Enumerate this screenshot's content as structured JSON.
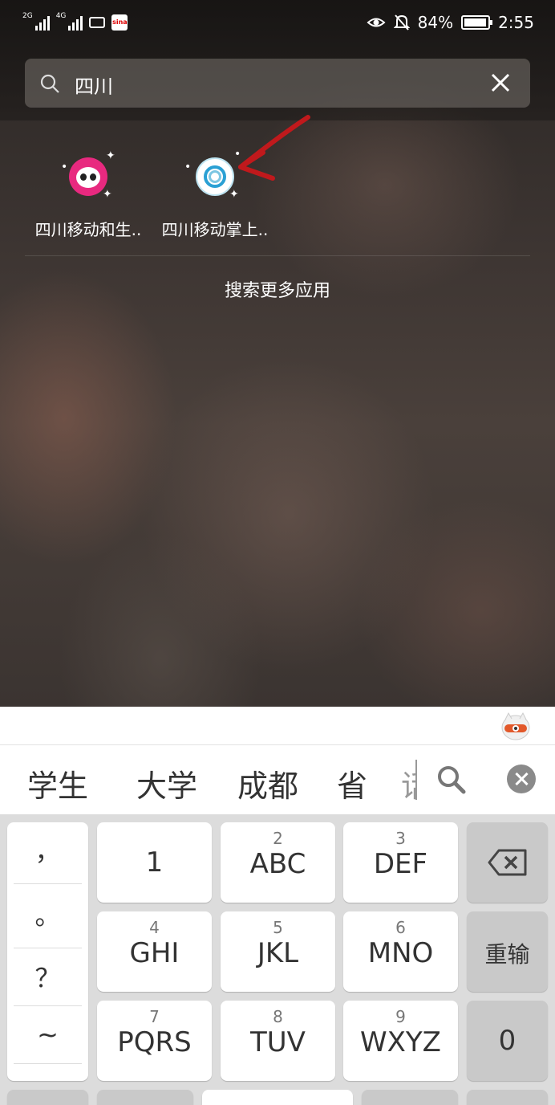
{
  "status_bar": {
    "network_1": "2G",
    "network_2": "4G",
    "battery_percent": "84%",
    "battery_level": 0.84,
    "time": "2:55"
  },
  "search": {
    "query": "四川"
  },
  "apps": [
    {
      "label": "四川移动和生..",
      "icon": "panda-app-icon"
    },
    {
      "label": "四川移动掌上..",
      "icon": "china-mobile-icon"
    }
  ],
  "more_apps": "搜索更多应用",
  "annotation_color": "#c0191c",
  "keyboard": {
    "candidates": [
      "学生",
      "大学",
      "成都",
      "省",
      "话"
    ],
    "punctuation": [
      "，",
      "。",
      "？",
      "~"
    ],
    "row1": {
      "k1": "1",
      "k2_num": "2",
      "k2": "ABC",
      "k3_num": "3",
      "k3": "DEF"
    },
    "row2": {
      "k1_num": "4",
      "k1": "GHI",
      "k2_num": "5",
      "k2": "JKL",
      "k3_num": "6",
      "k3": "MNO",
      "side": "重输"
    },
    "row3": {
      "k1_num": "7",
      "k1": "PQRS",
      "k2_num": "8",
      "k2": "TUV",
      "k3_num": "9",
      "k3": "WXYZ",
      "side": "0"
    }
  }
}
